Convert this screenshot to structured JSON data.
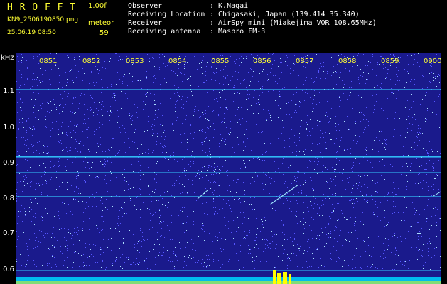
{
  "header": {
    "logo": "H R O F F T",
    "version": "1.00f",
    "filename": "KN9_2506190850.png",
    "mode": "meteor",
    "datetime": "25.06.19 08:50",
    "count": "59",
    "info": [
      {
        "label": "Observer",
        "value": ": K.Nagai"
      },
      {
        "label": "Receiving Location",
        "value": ": Chigasaki, Japan (139.414 35.340)"
      },
      {
        "label": "Receiver",
        "value": ": AirSpy mini (Miakejima VOR 108.65MHz)"
      },
      {
        "label": "Receiving antenna",
        "value": ": Maspro FM-3"
      }
    ]
  },
  "axis": {
    "unit": "kHz",
    "yticks": [
      "1.1",
      "1.0",
      "0.9",
      "0.8",
      "0.7",
      "0.6"
    ],
    "time_labels": [
      "0851",
      "0852",
      "0853",
      "0854",
      "0855",
      "0856",
      "0857",
      "0858",
      "0859",
      "0900"
    ]
  },
  "colors": {
    "background_noise": "#1a1a8c",
    "carrier_line": "#33ccff",
    "text": "#ffff33",
    "label": "#ffffff"
  }
}
